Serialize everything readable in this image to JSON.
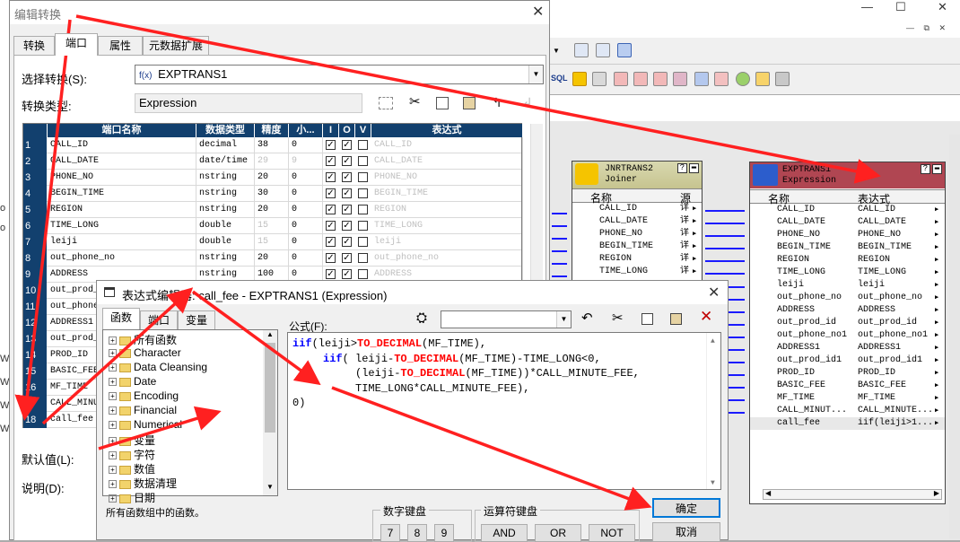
{
  "bg": {
    "window_controls": [
      "—",
      "☐",
      "✕"
    ],
    "restore_controls": [
      "—",
      "⧉",
      "✕"
    ],
    "side_letters": [
      "o",
      "o",
      "W",
      "W",
      "W",
      "W"
    ]
  },
  "main_dialog": {
    "title": "编辑转换",
    "tabs": [
      "转换",
      "端口",
      "属性",
      "元数据扩展"
    ],
    "select_label": "选择转换(S):",
    "select_value": "EXPTRANS1",
    "select_icon": "f(x)",
    "type_label": "转换类型:",
    "type_value": "Expression",
    "default_label": "默认值(L):",
    "desc_label": "说明(D):"
  },
  "grid": {
    "headers": [
      "端口名称",
      "数据类型",
      "精度",
      "小...",
      "I",
      "O",
      "V",
      "表达式"
    ],
    "rows": [
      {
        "n": "1",
        "name": "CALL_ID",
        "type": "decimal",
        "prec": "38",
        "scale": "0",
        "prec_gray": false,
        "i": true,
        "o": true,
        "v": false,
        "expr": "CALL_ID"
      },
      {
        "n": "2",
        "name": "CALL_DATE",
        "type": "date/time",
        "prec": "29",
        "scale": "9",
        "prec_gray": true,
        "i": true,
        "o": true,
        "v": false,
        "expr": "CALL_DATE"
      },
      {
        "n": "3",
        "name": "PHONE_NO",
        "type": "nstring",
        "prec": "20",
        "scale": "0",
        "prec_gray": false,
        "i": true,
        "o": true,
        "v": false,
        "expr": "PHONE_NO"
      },
      {
        "n": "4",
        "name": "BEGIN_TIME",
        "type": "nstring",
        "prec": "30",
        "scale": "0",
        "prec_gray": false,
        "i": true,
        "o": true,
        "v": false,
        "expr": "BEGIN_TIME"
      },
      {
        "n": "5",
        "name": "REGION",
        "type": "nstring",
        "prec": "20",
        "scale": "0",
        "prec_gray": false,
        "i": true,
        "o": true,
        "v": false,
        "expr": "REGION"
      },
      {
        "n": "6",
        "name": "TIME_LONG",
        "type": "double",
        "prec": "15",
        "scale": "0",
        "prec_gray": true,
        "i": true,
        "o": true,
        "v": false,
        "expr": "TIME_LONG"
      },
      {
        "n": "7",
        "name": "leiji",
        "type": "double",
        "prec": "15",
        "scale": "0",
        "prec_gray": true,
        "i": true,
        "o": true,
        "v": false,
        "expr": "leiji"
      },
      {
        "n": "8",
        "name": "out_phone_no",
        "type": "nstring",
        "prec": "20",
        "scale": "0",
        "prec_gray": false,
        "i": true,
        "o": true,
        "v": false,
        "expr": "out_phone_no"
      },
      {
        "n": "9",
        "name": "ADDRESS",
        "type": "nstring",
        "prec": "100",
        "scale": "0",
        "prec_gray": false,
        "i": true,
        "o": true,
        "v": false,
        "expr": "ADDRESS"
      },
      {
        "n": "10",
        "name": "out_prod_id",
        "type": "",
        "prec": "",
        "scale": "",
        "prec_gray": false,
        "i": false,
        "o": false,
        "v": false,
        "expr": ""
      },
      {
        "n": "11",
        "name": "out_phone_no1",
        "type": "",
        "prec": "",
        "scale": "",
        "prec_gray": false,
        "i": false,
        "o": false,
        "v": false,
        "expr": ""
      },
      {
        "n": "12",
        "name": "ADDRESS1",
        "type": "",
        "prec": "",
        "scale": "",
        "prec_gray": false,
        "i": false,
        "o": false,
        "v": false,
        "expr": ""
      },
      {
        "n": "13",
        "name": "out_prod_id1",
        "type": "",
        "prec": "",
        "scale": "",
        "prec_gray": false,
        "i": false,
        "o": false,
        "v": false,
        "expr": ""
      },
      {
        "n": "14",
        "name": "PROD_ID",
        "type": "",
        "prec": "",
        "scale": "",
        "prec_gray": false,
        "i": false,
        "o": false,
        "v": false,
        "expr": ""
      },
      {
        "n": "15",
        "name": "BASIC_FEE",
        "type": "",
        "prec": "",
        "scale": "",
        "prec_gray": false,
        "i": false,
        "o": false,
        "v": false,
        "expr": ""
      },
      {
        "n": "16",
        "name": "MF_TIME",
        "type": "",
        "prec": "",
        "scale": "",
        "prec_gray": false,
        "i": false,
        "o": false,
        "v": false,
        "expr": ""
      },
      {
        "n": "17",
        "name": "CALL_MINUTE_FEE",
        "type": "",
        "prec": "",
        "scale": "",
        "prec_gray": false,
        "i": false,
        "o": false,
        "v": false,
        "expr": ""
      },
      {
        "n": "18",
        "name": "call_fee",
        "type": "",
        "prec": "",
        "scale": "",
        "prec_gray": false,
        "i": false,
        "o": false,
        "v": false,
        "expr": ""
      }
    ]
  },
  "joiner": {
    "title1": "JNRTRANS2",
    "title2": "Joiner",
    "col_name": "名称",
    "col_src": "源",
    "rows": [
      "CALL_ID",
      "CALL_DATE",
      "PHONE_NO",
      "BEGIN_TIME",
      "REGION",
      "TIME_LONG"
    ],
    "src_val": "详"
  },
  "expression_node": {
    "title1": "EXPTRANS1",
    "title2": "Expression",
    "col_name": "名称",
    "col_expr": "表达式",
    "rows": [
      [
        "CALL_ID",
        "CALL_ID"
      ],
      [
        "CALL_DATE",
        "CALL_DATE"
      ],
      [
        "PHONE_NO",
        "PHONE_NO"
      ],
      [
        "BEGIN_TIME",
        "BEGIN_TIME"
      ],
      [
        "REGION",
        "REGION"
      ],
      [
        "TIME_LONG",
        "TIME_LONG"
      ],
      [
        "leiji",
        "leiji"
      ],
      [
        "out_phone_no",
        "out_phone_no"
      ],
      [
        "ADDRESS",
        "ADDRESS"
      ],
      [
        "out_prod_id",
        "out_prod_id"
      ],
      [
        "out_phone_no1",
        "out_phone_no1"
      ],
      [
        "ADDRESS1",
        "ADDRESS1"
      ],
      [
        "out_prod_id1",
        "out_prod_id1"
      ],
      [
        "PROD_ID",
        "PROD_ID"
      ],
      [
        "BASIC_FEE",
        "BASIC_FEE"
      ],
      [
        "MF_TIME",
        "MF_TIME"
      ],
      [
        "CALL_MINUT...",
        "CALL_MINUTE..."
      ],
      [
        "call_fee",
        "iif(leiji>1..."
      ]
    ]
  },
  "expr_editor": {
    "title": "表达式编辑器: call_fee - EXPTRANS1 (Expression)",
    "tabs": [
      "函数",
      "端口",
      "变量"
    ],
    "formula_label": "公式(F):",
    "tree": [
      "所有函数",
      "Character",
      "Data Cleansing",
      "Date",
      "Encoding",
      "Financial",
      "Numerical",
      "变量",
      "字符",
      "数值",
      "数据清理",
      "日期"
    ],
    "tree_desc": "所有函数组中的函数。",
    "formula": {
      "l1a": "iif",
      "l1b": "(leiji>",
      "l1c": "TO_DECIMAL",
      "l1d": "(MF_TIME),",
      "l2a": "iif",
      "l2b": "( leiji-",
      "l2c": "TO_DECIMAL",
      "l2d": "(MF_TIME)-TIME_LONG<0,",
      "l3a": "(leiji-",
      "l3b": "TO_DECIMAL",
      "l3c": "(MF_TIME))*CALL_MINUTE_FEE,",
      "l4": "TIME_LONG*CALL_MINUTE_FEE),",
      "l5": "0)"
    },
    "numpad_label": "数字键盘",
    "numpad_keys": [
      "7",
      "8",
      "9"
    ],
    "opkeys_label": "运算符键盘",
    "op_keys": [
      "AND",
      "OR",
      "NOT"
    ],
    "ok": "确定",
    "cancel": "取消"
  },
  "colors": {
    "grid_header": "#12406e",
    "arrow": "#ff2020",
    "port_line": "#1a1aff"
  }
}
